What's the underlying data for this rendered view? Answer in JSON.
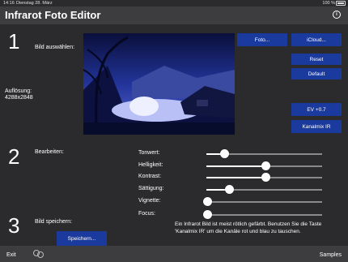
{
  "status": {
    "time": "14:16",
    "date": "Dienstag 28. März",
    "battery": "100 %"
  },
  "app": {
    "title": "Infrarot Foto Editor",
    "info_icon": "info-icon"
  },
  "section1": {
    "number": "1",
    "label": "Bild auswählen:",
    "resolution_label": "Auflösung:",
    "resolution_value": "4288x2848"
  },
  "buttons": {
    "foto": "Foto...",
    "icloud": "iCloud...",
    "reset": "Reset",
    "default": "Default",
    "ev": "EV +0.7",
    "kanalmix": "Kanalmix IR",
    "speichern": "Speichern..."
  },
  "section2": {
    "number": "2",
    "label": "Bearbeiten:"
  },
  "sliders": [
    {
      "label": "Tonwert:",
      "value": 0.15
    },
    {
      "label": "Helligkeit:",
      "value": 0.5
    },
    {
      "label": "Kontrast:",
      "value": 0.5
    },
    {
      "label": "Sättigung:",
      "value": 0.19
    },
    {
      "label": "Vignette:",
      "value": 0.0
    },
    {
      "label": "Focus:",
      "value": 0.0
    }
  ],
  "section3": {
    "number": "3",
    "label": "Bild speichern:"
  },
  "note": "Ein Infrarot Bild ist meist rötlich gefärbt. Benutzen Sie die Taste 'Kanalmix IR' um die Kanäle rot und blau zu tauschen.",
  "bottom": {
    "exit": "Exit",
    "samples": "Samples",
    "center_icon": "link-icon"
  },
  "colors": {
    "accent": "#1a3a9e",
    "background": "#2b2b2d",
    "bar": "#3d3d40"
  }
}
